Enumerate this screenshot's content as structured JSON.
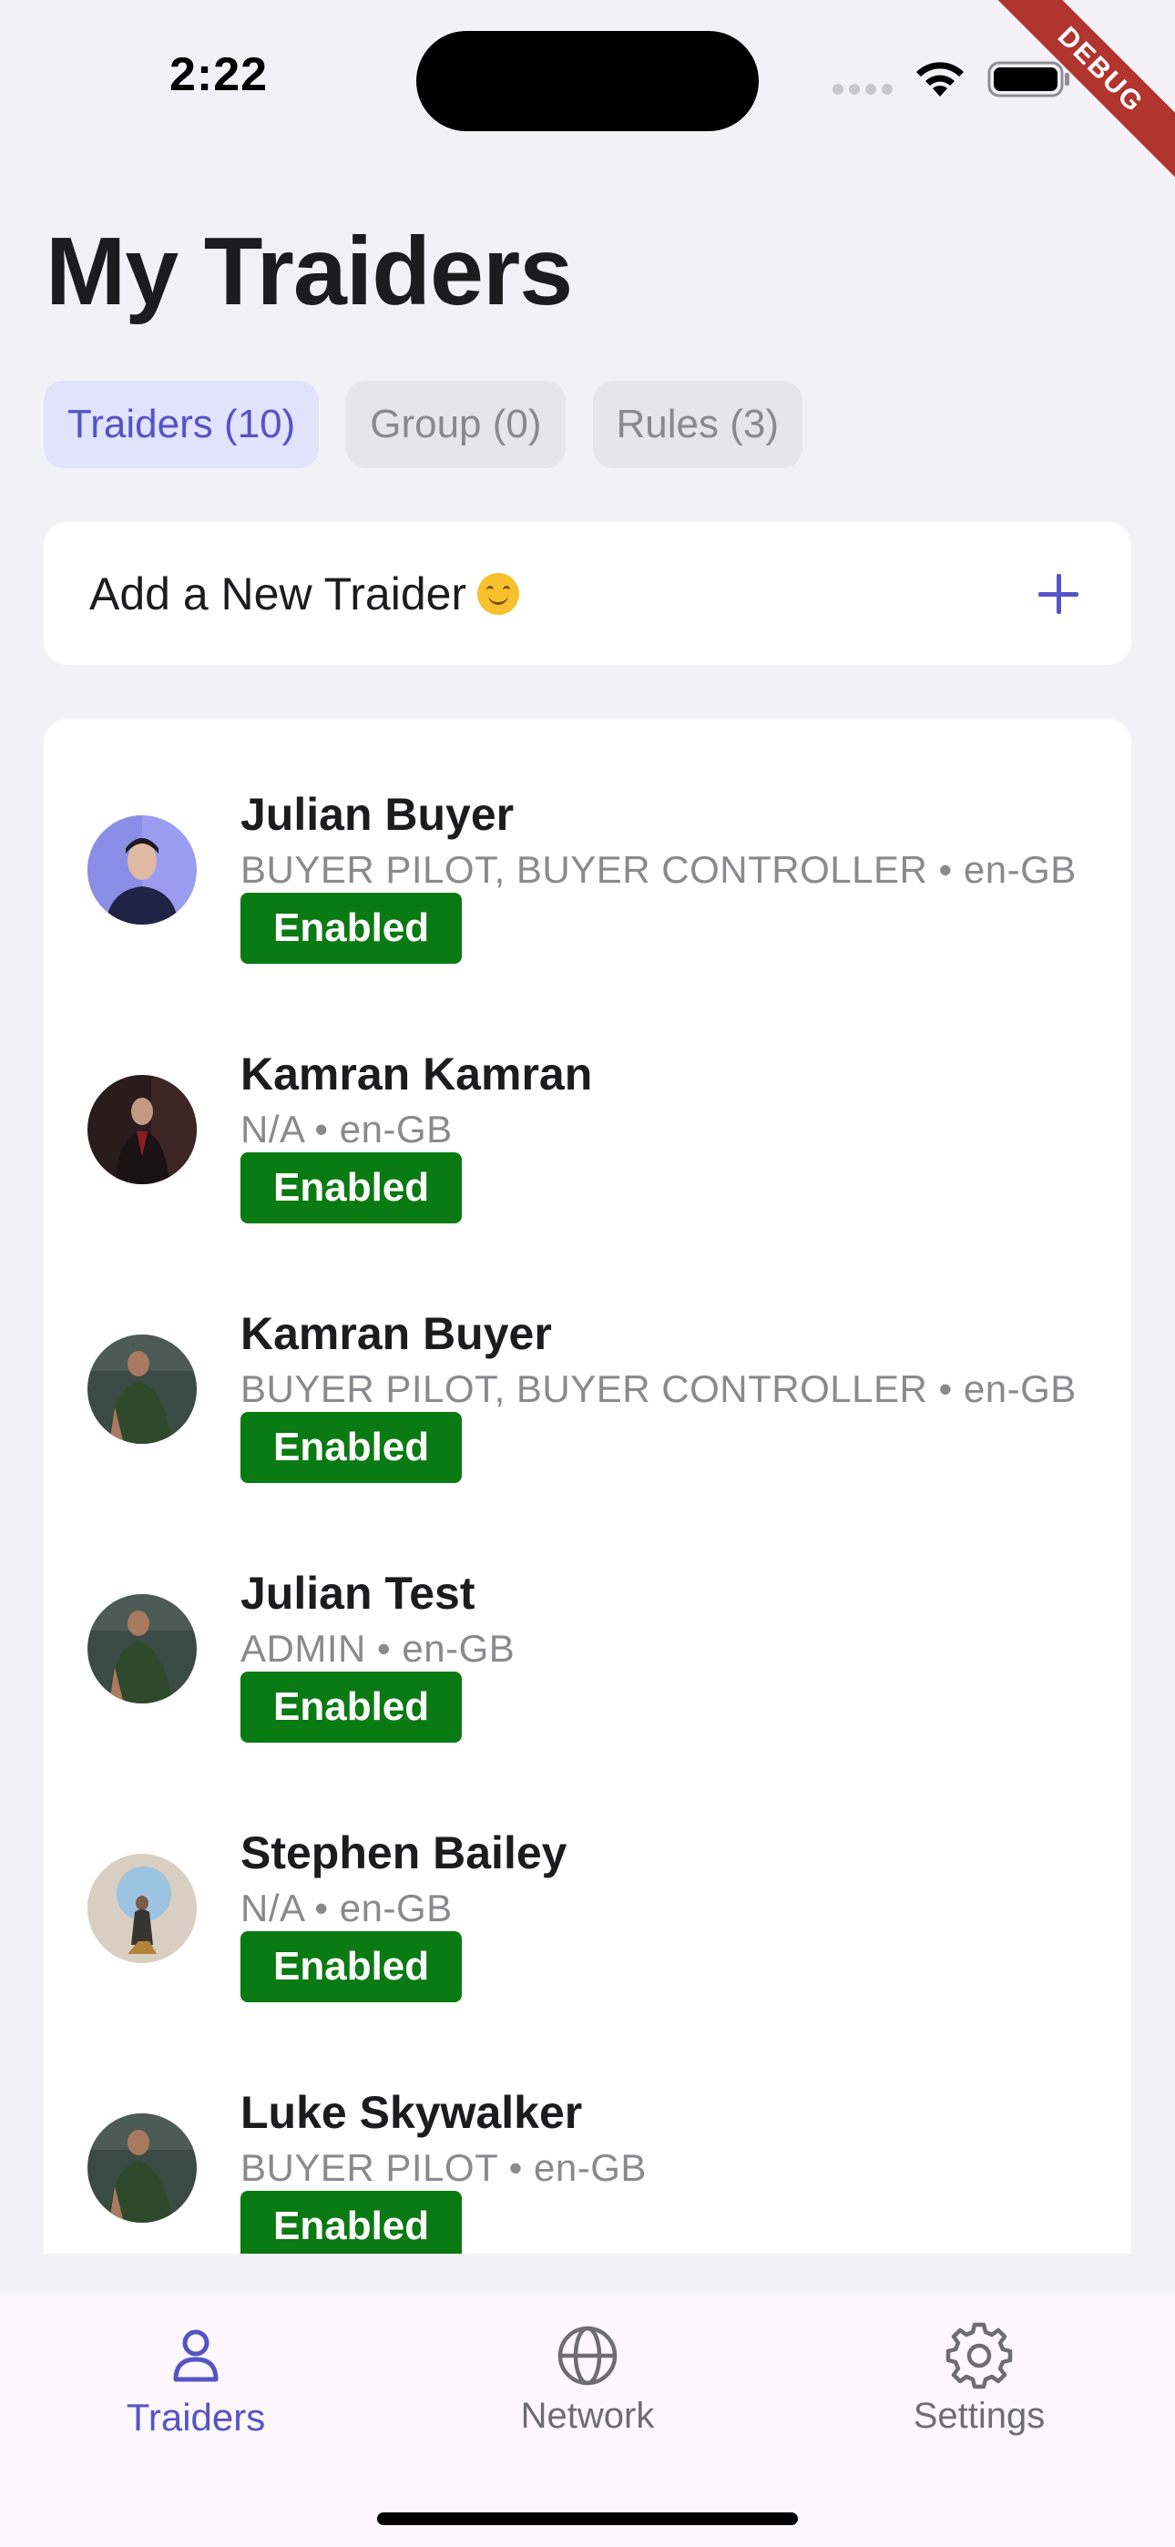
{
  "status_bar": {
    "time": "2:22"
  },
  "debug_label": "DEBUG",
  "page_title": "My Traiders",
  "tabs": [
    {
      "label": "Traiders (10)",
      "active": true
    },
    {
      "label": "Group (0)",
      "active": false
    },
    {
      "label": "Rules (3)",
      "active": false
    }
  ],
  "add_card": {
    "label": "Add a New Traider"
  },
  "traiders": [
    {
      "name": "Julian Buyer",
      "meta": "BUYER PILOT, BUYER CONTROLLER • en-GB",
      "status": "Enabled"
    },
    {
      "name": "Kamran Kamran",
      "meta": "N/A • en-GB",
      "status": "Enabled"
    },
    {
      "name": "Kamran Buyer",
      "meta": "BUYER PILOT, BUYER CONTROLLER • en-GB",
      "status": "Enabled"
    },
    {
      "name": "Julian Test",
      "meta": "ADMIN • en-GB",
      "status": "Enabled"
    },
    {
      "name": "Stephen Bailey",
      "meta": "N/A • en-GB",
      "status": "Enabled"
    },
    {
      "name": "Luke Skywalker",
      "meta": "BUYER PILOT • en-GB",
      "status": "Enabled"
    }
  ],
  "bottom_nav": [
    {
      "label": "Traiders",
      "icon": "person-icon",
      "active": true
    },
    {
      "label": "Network",
      "icon": "globe-icon",
      "active": false
    },
    {
      "label": "Settings",
      "icon": "gear-icon",
      "active": false
    }
  ],
  "colors": {
    "accent": "#5553c6",
    "enabled_badge": "#0a7a12",
    "background": "#f2f2f6"
  }
}
